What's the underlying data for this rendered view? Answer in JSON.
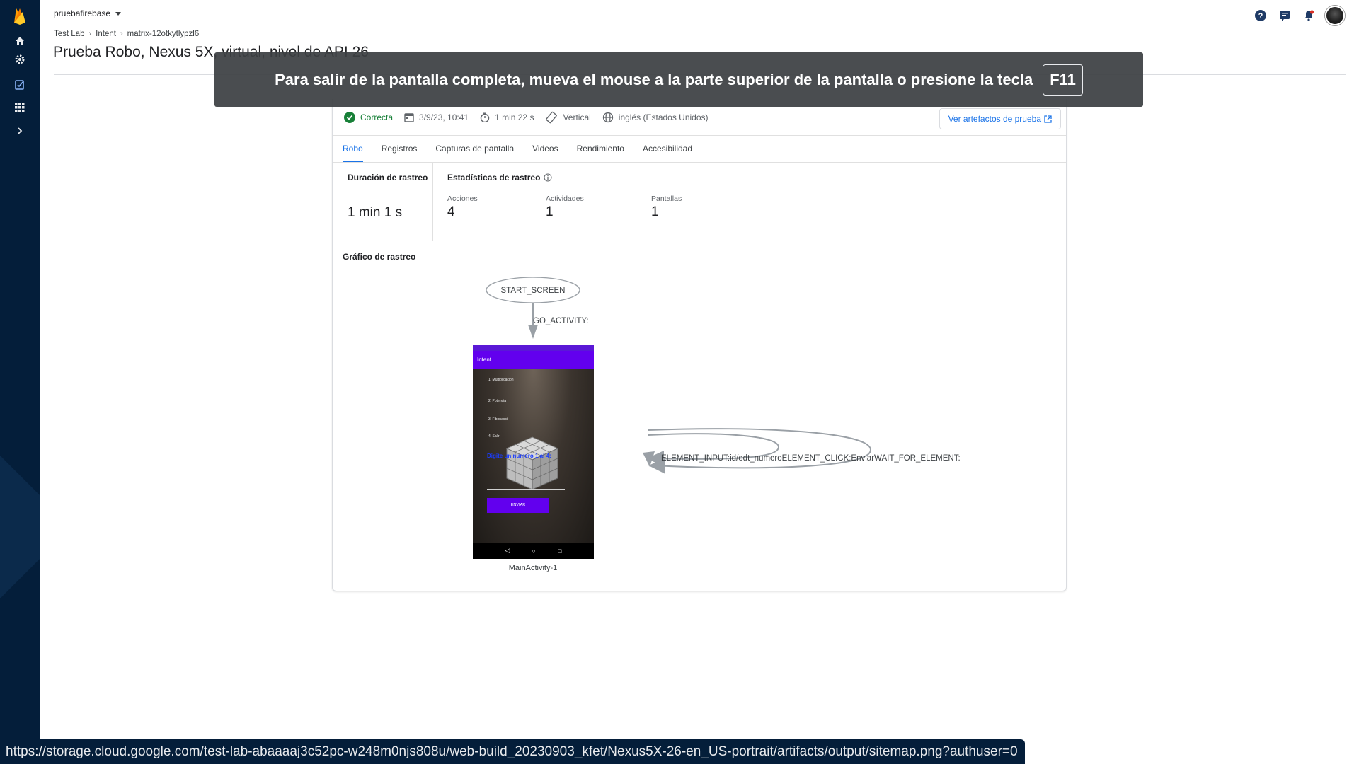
{
  "header": {
    "project_name": "pruebafirebase",
    "breadcrumb": [
      "Test Lab",
      "Intent",
      "matrix-12otkytlypzl6"
    ],
    "title": "Prueba Robo, Nexus 5X, virtual, nivel de API 26"
  },
  "overlay": {
    "message": "Para salir de la pantalla completa, mueva el mouse a la parte superior de la pantalla o presione la tecla",
    "key": "F11"
  },
  "summary": {
    "status": "Correcta",
    "date": "3/9/23, 10:41",
    "duration": "1 min 22 s",
    "orientation": "Vertical",
    "locale": "inglés (Estados Unidos)",
    "artifacts_button": "Ver artefactos de prueba"
  },
  "tabs": [
    "Robo",
    "Registros",
    "Capturas de pantalla",
    "Videos",
    "Rendimiento",
    "Accesibilidad"
  ],
  "stats": {
    "duration_label": "Duración de rastreo",
    "duration_value": "1 min 1 s",
    "crawl_label": "Estadísticas de rastreo",
    "metrics": [
      {
        "label": "Acciones",
        "value": "4"
      },
      {
        "label": "Actividades",
        "value": "1"
      },
      {
        "label": "Pantallas",
        "value": "1"
      }
    ]
  },
  "graph": {
    "title": "Gráfico de rastreo",
    "start_node": "START_SCREEN",
    "edge_go": "GO_ACTIVITY:",
    "screen_label": "MainActivity-1",
    "self_edges": "ELEMENT_INPUT:id/edt_numeroELEMENT_CLICK:EnviarWAIT_FOR_ELEMENT:"
  },
  "phone_screen": {
    "app_title": "Intent",
    "options": [
      "1. Multiplicacion",
      "2. Potencia",
      "3. Fibonacci",
      "4. Salir"
    ],
    "prompt": "Digite un numero 1 al 4:",
    "button": "ENVIAR"
  },
  "status_url": "https://storage.cloud.google.com/test-lab-abaaaaj3c52pc-w248m0njs808u/web-build_20230903_kfet/Nexus5X-26-en_US-portrait/artifacts/output/sitemap.png?authuser=0",
  "colors": {
    "rail": "#041e3a",
    "accent": "#1a73e8",
    "success": "#188038",
    "app_purple": "#6200ee"
  }
}
